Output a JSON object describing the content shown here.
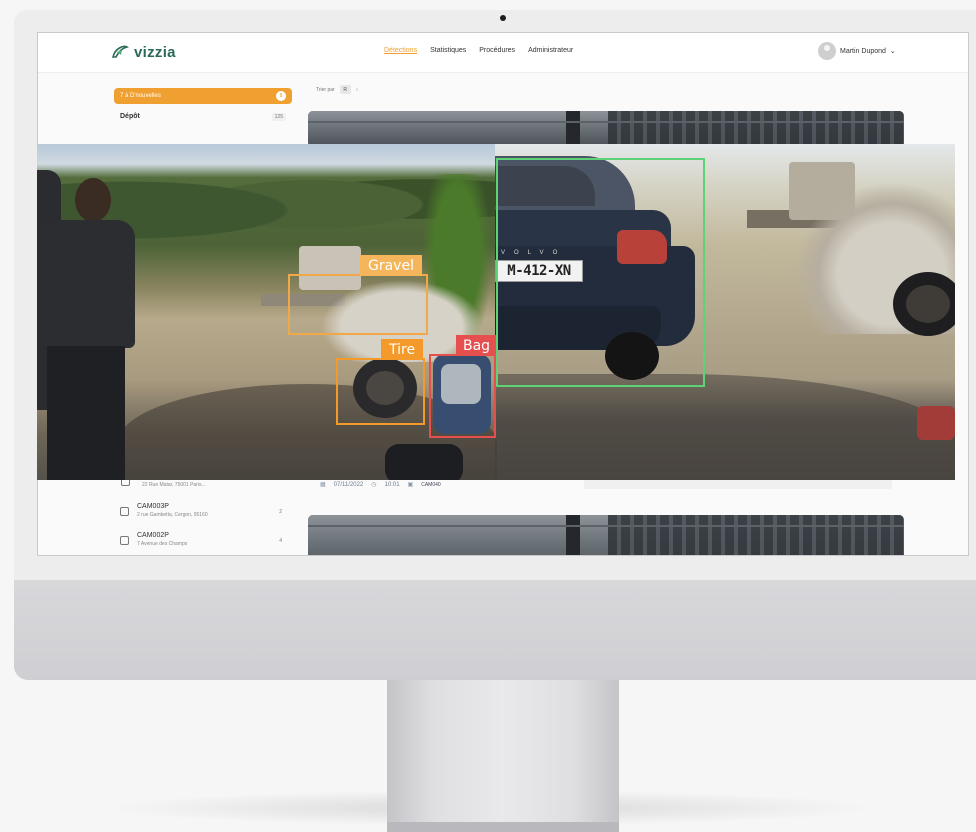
{
  "app": {
    "logo_text": "vizzia",
    "nav": [
      "Détections",
      "Statistiques",
      "Procédures",
      "Administrateur"
    ],
    "active_nav_index": 0,
    "user_name": "Martin Dupond",
    "user_chevron": "⌄"
  },
  "sidebar": {
    "filter_pill_label": "7 à D'nouvelles",
    "filter_pill_count": "8",
    "depot_label": "Dépôt",
    "depot_count": "125",
    "fragment_address": "22 Rue Matar, 75001 Paris...",
    "cameras": [
      {
        "name": "CAM003P",
        "address": "2 rue Gambetta, Cergon, 95160",
        "count": "2"
      },
      {
        "name": "CAM002P",
        "address": "7 Avenue des Champs",
        "count": "4"
      }
    ]
  },
  "main": {
    "sort_label": "Trier par",
    "sort_value": "R",
    "sort_arrow": "↕",
    "date_icon": "calendar-icon",
    "date": "07/11/2022",
    "time": "10:01",
    "camera_tag": "CAM040"
  },
  "detection_photo": {
    "plate_text": "M-412-XN",
    "brand_text": "VOLVO",
    "boxes": [
      {
        "label": "Gravel",
        "color": "#f5b55a"
      },
      {
        "label": "Tire",
        "color": "#f39a2a"
      },
      {
        "label": "Bag",
        "color": "#e5504f"
      },
      {
        "label": "",
        "color": "#5ed277"
      }
    ]
  },
  "colors": {
    "accent": "#f0a030",
    "brand": "#2b6a5a"
  }
}
